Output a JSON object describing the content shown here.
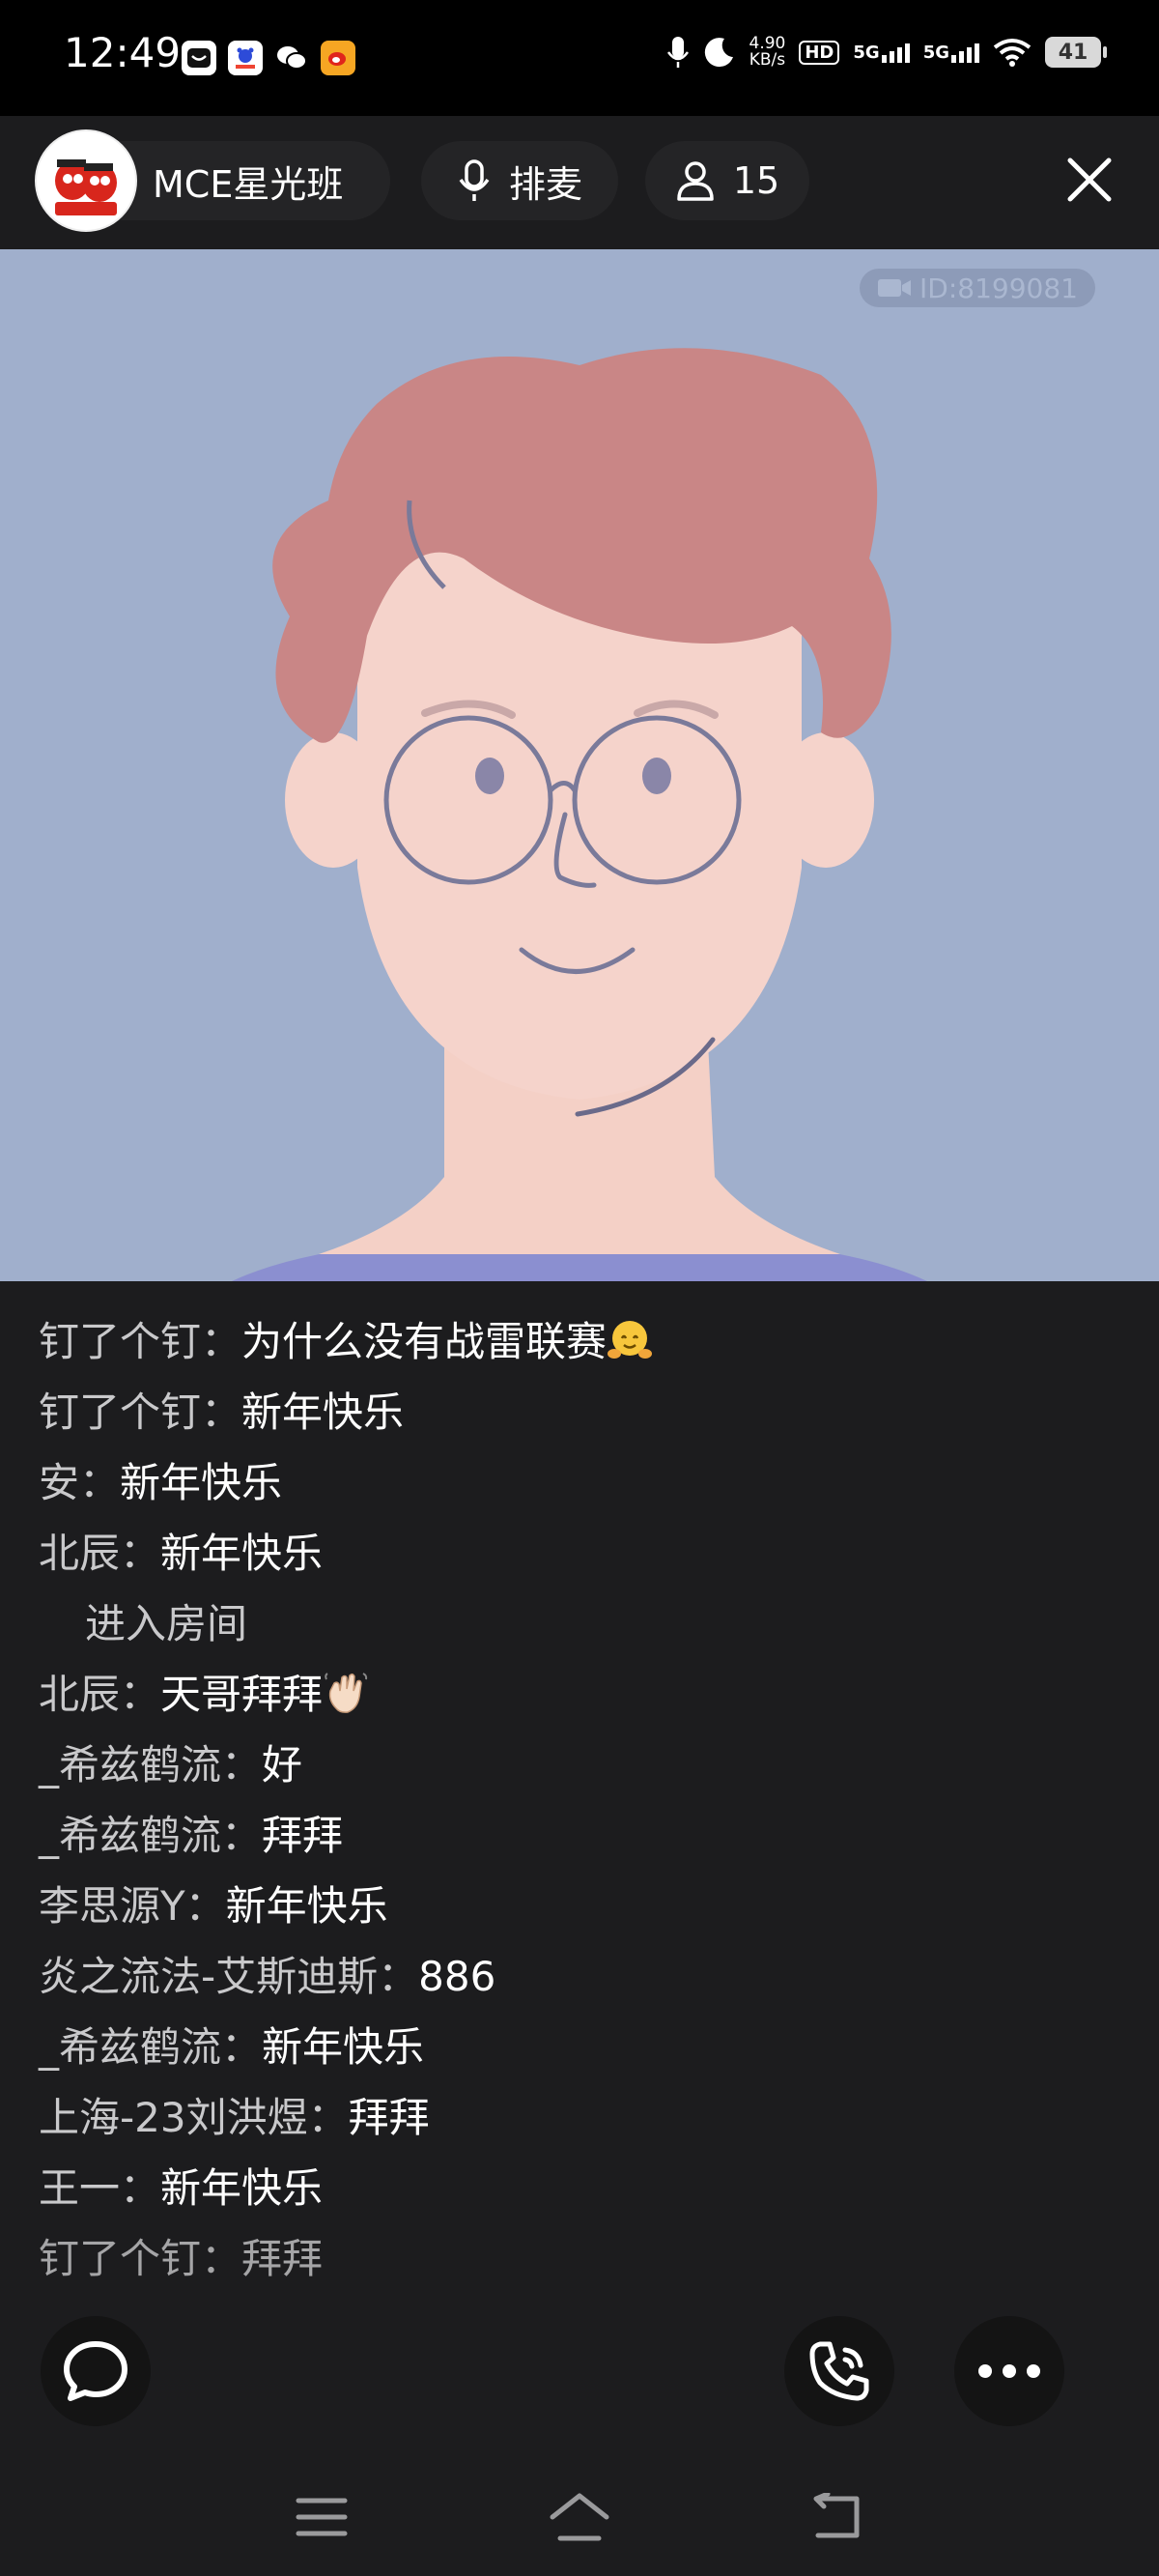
{
  "status_bar": {
    "time": "12:49",
    "speed_value": "4.90",
    "speed_unit": "KB/s",
    "hd_label": "HD",
    "network_1": "5G",
    "network_2": "5G",
    "battery": "41"
  },
  "header": {
    "room_name": "MCE星光班",
    "queue_label": "排麦",
    "member_count": "15"
  },
  "video": {
    "id_label": "ID:8199081"
  },
  "chat": [
    {
      "user": "钉了个钉：",
      "msg": "为什么没有战雷联赛",
      "emoji": "hug"
    },
    {
      "user": "钉了个钉：",
      "msg": "新年快乐"
    },
    {
      "user": "安：",
      "msg": "新年快乐"
    },
    {
      "user": "北辰：",
      "msg": "新年快乐"
    },
    {
      "user": "",
      "msg": "进入房间",
      "system": true
    },
    {
      "user": "北辰：",
      "msg": "天哥拜拜",
      "emoji": "wave"
    },
    {
      "user": "_希兹鹤流：",
      "msg": "好"
    },
    {
      "user": "_希兹鹤流：",
      "msg": "拜拜"
    },
    {
      "user": "李思源Y：",
      "msg": "新年快乐"
    },
    {
      "user": "炎之流法-艾斯迪斯：",
      "msg": "886"
    },
    {
      "user": "_希兹鹤流：",
      "msg": "新年快乐"
    },
    {
      "user": "上海-23刘洪煜：",
      "msg": "拜拜"
    },
    {
      "user": "王一：",
      "msg": "新年快乐"
    },
    {
      "user": "钉了个钉：",
      "msg": "拜拜"
    }
  ],
  "colors": {
    "background": "#1c1c1e",
    "video_bg": "#a0afcc",
    "hair": "#c98686",
    "skin": "#f5d3cb"
  }
}
